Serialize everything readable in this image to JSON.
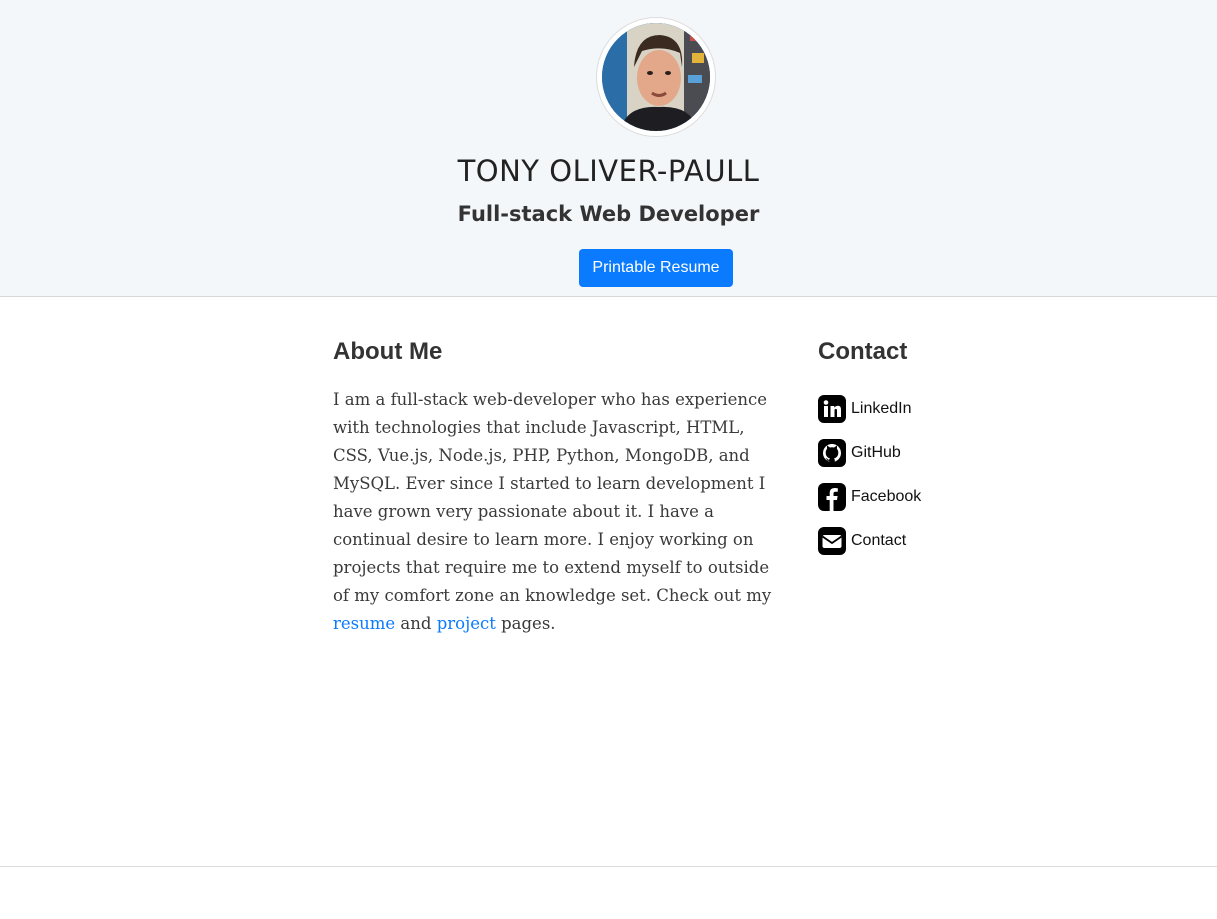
{
  "profile": {
    "name": "TONY OLIVER-PAULL",
    "role": "Full-stack Web Developer",
    "resume_button": "Printable Resume",
    "avatar_icon": "profile-photo"
  },
  "about": {
    "title": "About Me",
    "text_before": "I am a full-stack web-developer who has experience with technologies that include Javascript, HTML, CSS, Vue.js, Node.js, PHP, Python, MongoDB, and MySQL. Ever since I started to learn development I have grown very passionate about it. I have a continual desire to learn more. I enjoy working on projects that require me to extend myself to outside of my comfort zone an knowledge set. Check out my ",
    "link1": "resume",
    "text_middle": " and ",
    "link2": "project",
    "text_after": " pages."
  },
  "contact": {
    "title": "Contact",
    "items": [
      {
        "label": "LinkedIn",
        "icon": "linkedin-icon"
      },
      {
        "label": "GitHub",
        "icon": "github-icon"
      },
      {
        "label": "Facebook",
        "icon": "facebook-icon"
      },
      {
        "label": "Contact",
        "icon": "envelope-icon"
      }
    ]
  },
  "colors": {
    "accent": "#0a7bff",
    "hero_bg": "#f4f7fa"
  }
}
